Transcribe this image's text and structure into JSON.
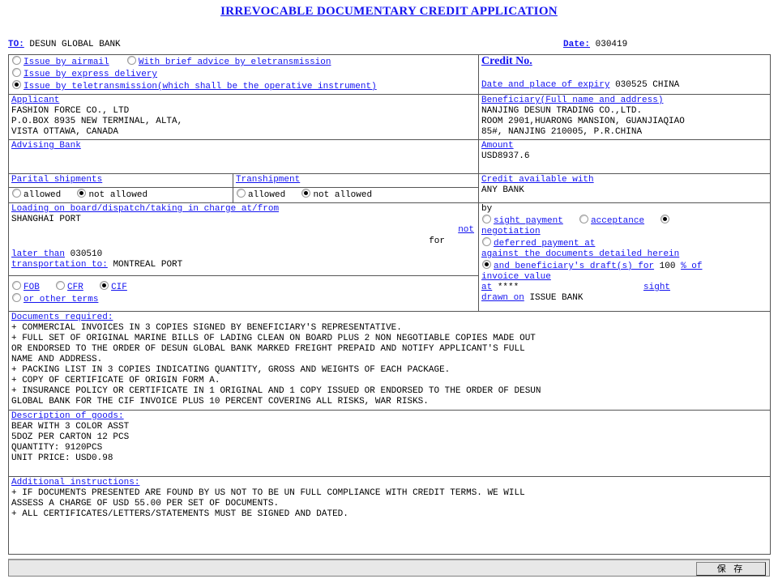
{
  "document": {
    "title": "IRREVOCABLE DOCUMENTARY CREDIT APPLICATION",
    "to_label": "TO:",
    "to_value": "DESUN GLOBAL BANK",
    "date_label": "Date:",
    "date_value": "030419"
  },
  "issue": {
    "options": [
      {
        "label": "Issue by airmail",
        "selected": false
      },
      {
        "label": "With brief advice by eletransmission",
        "selected": false
      },
      {
        "label": "Issue by express delivery",
        "selected": false
      },
      {
        "label": "Issue by teletransmission(which shall be the operative instrument)",
        "selected": true
      }
    ]
  },
  "credit": {
    "credit_no_label": "Credit No.",
    "credit_no_value": "",
    "expiry_label": "Date and place of expiry",
    "expiry_value": "030525 CHINA"
  },
  "applicant": {
    "label": "Applicant",
    "lines": [
      "FASHION FORCE CO., LTD",
      "P.O.BOX 8935 NEW TERMINAL, ALTA,",
      "VISTA OTTAWA, CANADA"
    ]
  },
  "beneficiary": {
    "label": "Beneficiary(Full name and address)",
    "lines": [
      "NANJING DESUN TRADING CO.,LTD.",
      "ROOM 2901,HUARONG MANSION, GUANJIAQIAO",
      "85#, NANJING 210005, P.R.CHINA"
    ]
  },
  "advising_bank": {
    "label": "Advising Bank",
    "value": ""
  },
  "amount": {
    "label": "Amount",
    "value": "USD8937.6"
  },
  "partial_shipments": {
    "label": "Parital shipments",
    "options": [
      {
        "label": "allowed",
        "selected": false
      },
      {
        "label": "not allowed",
        "selected": true
      }
    ]
  },
  "transhipment": {
    "label": "Transhipment",
    "options": [
      {
        "label": "allowed",
        "selected": false
      },
      {
        "label": "not allowed",
        "selected": true
      }
    ]
  },
  "credit_available": {
    "label": "Credit available with",
    "value": "ANY BANK",
    "by_label": "by",
    "methods": [
      {
        "label": "sight payment",
        "selected": false
      },
      {
        "label": "acceptance",
        "selected": false
      },
      {
        "label": "negotiation",
        "selected": true
      },
      {
        "label": "deferred payment at",
        "selected": false
      }
    ],
    "against_label": "against the documents detailed herein",
    "draft_label": "and beneficiary's draft(s) for",
    "draft_selected": true,
    "draft_percent": "100",
    "percent_suffix": "% of invoice value",
    "at_label": "at",
    "at_value": "****",
    "sight_label": "sight",
    "drawn_on_label": "drawn on",
    "drawn_on_value": "ISSUE BANK"
  },
  "loading": {
    "label": "Loading on board/dispatch/taking in charge at/from",
    "value": "SHANGHAI PORT",
    "not_label": "not",
    "for_label": "for",
    "later_than_label": "later than",
    "later_than_value": "030510",
    "transportation_label": "transportation to:",
    "transportation_value": "MONTREAL PORT"
  },
  "terms": {
    "options": [
      {
        "label": "FOB",
        "selected": false
      },
      {
        "label": "CFR",
        "selected": false
      },
      {
        "label": "CIF",
        "selected": true
      },
      {
        "label": "or other terms",
        "selected": false
      }
    ]
  },
  "documents_required": {
    "label": "Documents required:",
    "lines": [
      "+ COMMERCIAL INVOICES IN 3 COPIES SIGNED BY BENEFICIARY'S REPRESENTATIVE.",
      "+ FULL SET OF ORIGINAL MARINE BILLS OF LADING CLEAN ON BOARD PLUS 2 NON NEGOTIABLE COPIES MADE OUT",
      "OR ENDORSED TO THE ORDER OF DESUN GLOBAL BANK MARKED FREIGHT PREPAID AND NOTIFY APPLICANT'S FULL",
      "NAME AND ADDRESS.",
      "+ PACKING LIST IN 3 COPIES INDICATING QUANTITY, GROSS AND WEIGHTS OF EACH PACKAGE.",
      "+ COPY OF CERTIFICATE OF ORIGIN FORM A.",
      "+ INSURANCE POLICY OR CERTIFICATE IN 1 ORIGINAL AND 1 COPY ISSUED OR ENDORSED TO THE ORDER OF DESUN",
      "GLOBAL BANK FOR THE CIF INVOICE PLUS 10 PERCENT COVERING ALL RISKS, WAR RISKS."
    ]
  },
  "description_of_goods": {
    "label": "Description of goods:",
    "lines": [
      "BEAR WITH 3 COLOR ASST",
      "5DOZ PER CARTON 12 PCS",
      "QUANTITY: 9120PCS",
      "UNIT PRICE: USD0.98"
    ]
  },
  "additional_instructions": {
    "label": "Additional instructions:",
    "lines": [
      "+ IF DOCUMENTS PRESENTED ARE FOUND BY US NOT TO BE UN FULL COMPLIANCE WITH CREDIT TERMS. WE WILL",
      "ASSESS A CHARGE OF USD 55.00 PER SET OF DOCUMENTS.",
      "+ ALL CERTIFICATES/LETTERS/STATEMENTS MUST BE SIGNED AND DATED."
    ]
  },
  "toolbar": {
    "save_label": "保 存"
  },
  "colors": {
    "link": "#1414f0",
    "text": "#000000",
    "border": "#555555",
    "toolbar_bg": "#e8e8e8"
  }
}
